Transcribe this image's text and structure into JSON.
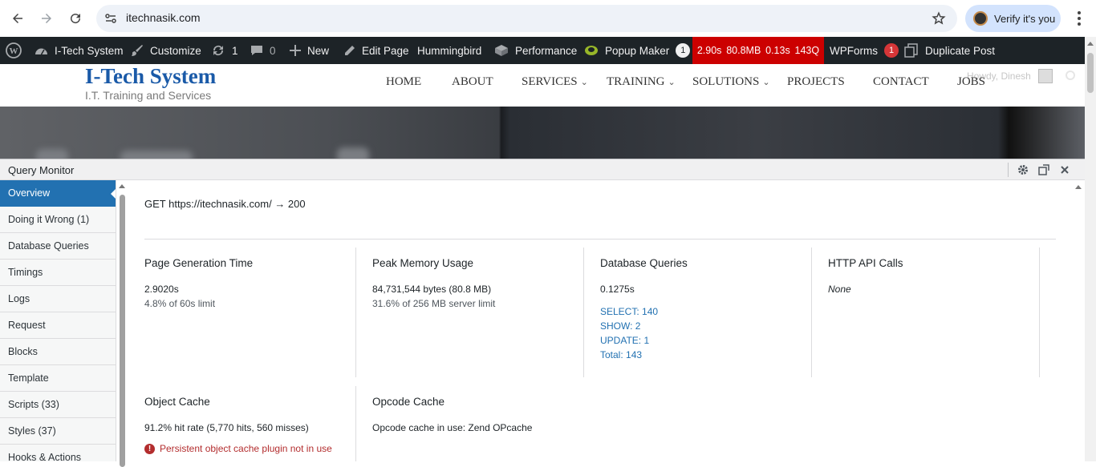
{
  "browser": {
    "url": "itechnasik.com",
    "verify_label": "Verify it's you"
  },
  "adminbar": {
    "site_name": "I-Tech System",
    "customize": "Customize",
    "updates_count": "1",
    "comments_count": "0",
    "new_label": "New",
    "edit_page": "Edit Page",
    "hummingbird": "Hummingbird",
    "performance": "Performance",
    "popup_maker": "Popup Maker",
    "popup_maker_count": "1",
    "qm_time": "2.90s",
    "qm_memory": "80.8MB",
    "qm_db_time": "0.13s",
    "qm_queries": "143Q",
    "wpforms": "WPForms",
    "wpforms_count": "1",
    "duplicate_post": "Duplicate Post"
  },
  "site": {
    "title": "I-Tech System",
    "tagline": "I.T. Training and Services",
    "menu": [
      "HOME",
      "ABOUT",
      "SERVICES",
      "TRAINING",
      "SOLUTIONS",
      "PROJECTS",
      "CONTACT",
      "JOBS"
    ],
    "howdy": "Howdy, Dinesh"
  },
  "qm": {
    "title": "Query Monitor",
    "nav": [
      "Overview",
      "Doing it Wrong (1)",
      "Database Queries",
      "Timings",
      "Logs",
      "Request",
      "Blocks",
      "Template",
      "Scripts (33)",
      "Styles (37)",
      "Hooks & Actions"
    ],
    "request": "GET https://itechnasik.com/ → 200",
    "page_gen": {
      "title": "Page Generation Time",
      "value": "2.9020s",
      "sub": "4.8% of 60s limit"
    },
    "memory": {
      "title": "Peak Memory Usage",
      "value": "84,731,544 bytes (80.8 MB)",
      "sub": "31.6% of 256 MB server limit"
    },
    "db": {
      "title": "Database Queries",
      "value": "0.1275s",
      "select": "SELECT: 140",
      "show": "SHOW: 2",
      "update": "UPDATE: 1",
      "total": "Total: 143"
    },
    "http": {
      "title": "HTTP API Calls",
      "value": "None"
    },
    "object_cache": {
      "title": "Object Cache",
      "value": "91.2% hit rate (5,770 hits, 560 misses)",
      "warning": "Persistent object cache plugin not in use"
    },
    "opcode": {
      "title": "Opcode Cache",
      "value": "Opcode cache in use: Zend OPcache"
    }
  }
}
